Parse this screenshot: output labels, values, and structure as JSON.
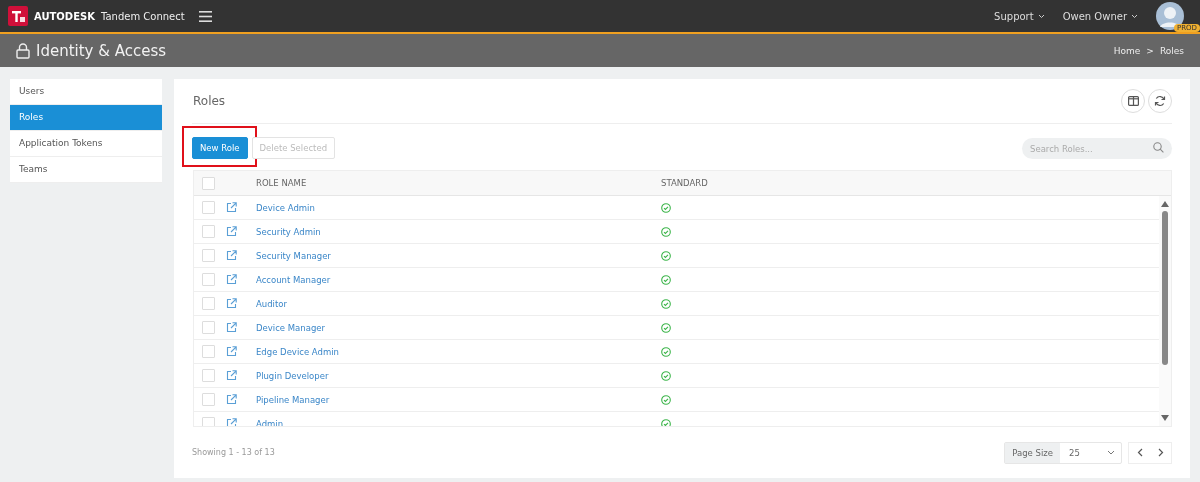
{
  "top_bar": {
    "brand": "AUTODESK",
    "product": "Tandem Connect",
    "menus": [
      {
        "label": "Support"
      },
      {
        "label": "Owen Owner"
      }
    ],
    "avatar_badge": "PROD"
  },
  "header": {
    "title": "Identity & Access",
    "breadcrumb": [
      "Home",
      "Roles"
    ],
    "separator": ">"
  },
  "sidebar": {
    "items": [
      {
        "label": "Users",
        "selected": false
      },
      {
        "label": "Roles",
        "selected": true
      },
      {
        "label": "Application Tokens",
        "selected": false
      },
      {
        "label": "Teams",
        "selected": false
      }
    ]
  },
  "panel": {
    "title": "Roles",
    "toolbar": {
      "buttons": [
        {
          "label": "New Role",
          "kind": "primary",
          "highlighted": true
        },
        {
          "label": "Delete Selected",
          "kind": "disabled",
          "highlighted": false
        }
      ]
    },
    "search": {
      "placeholder": "Search Roles..."
    }
  },
  "table": {
    "select_all_checked": false,
    "columns": [
      "ROLE NAME",
      "STANDARD"
    ],
    "rows": [
      {
        "name": "Device Admin",
        "checked": false,
        "standard": true
      },
      {
        "name": "Security Admin",
        "checked": false,
        "standard": true
      },
      {
        "name": "Security Manager",
        "checked": false,
        "standard": true
      },
      {
        "name": "Account Manager",
        "checked": false,
        "standard": true
      },
      {
        "name": "Auditor",
        "checked": false,
        "standard": true
      },
      {
        "name": "Device Manager",
        "checked": false,
        "standard": true
      },
      {
        "name": "Edge Device Admin",
        "checked": false,
        "standard": true
      },
      {
        "name": "Plugin Developer",
        "checked": false,
        "standard": true
      },
      {
        "name": "Pipeline Manager",
        "checked": false,
        "standard": true
      },
      {
        "name": "Admin",
        "checked": false,
        "standard": true
      }
    ]
  },
  "footer": {
    "showing": "Showing 1 - 13 of 13",
    "page_size_label": "Page Size",
    "page_size": "25"
  }
}
